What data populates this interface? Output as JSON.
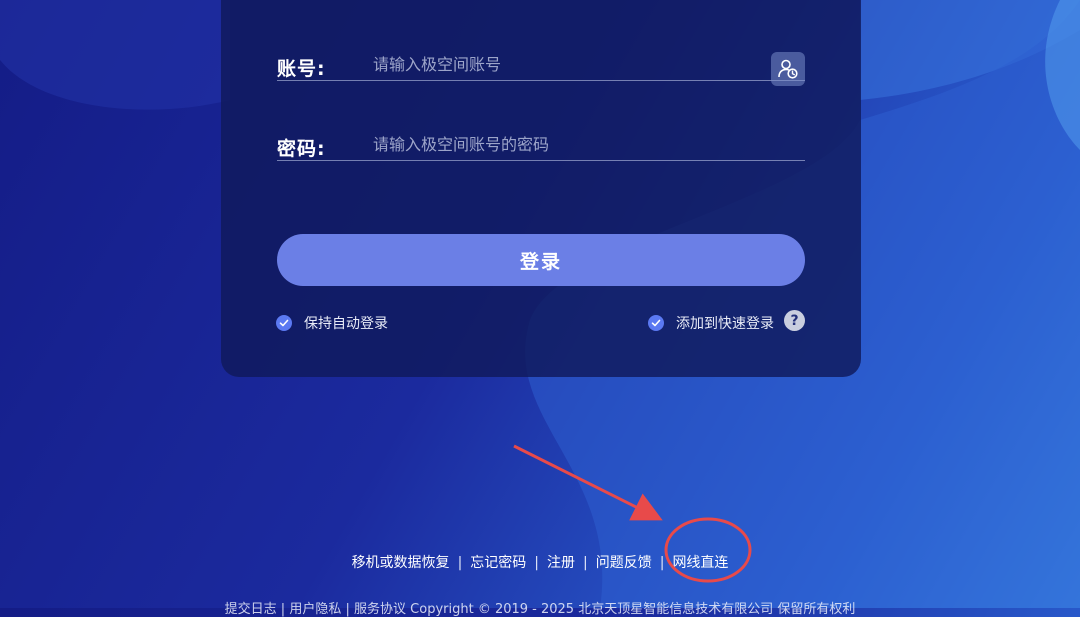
{
  "login": {
    "account_label": "账号:",
    "account_placeholder": "请输入极空间账号",
    "password_label": "密码:",
    "password_placeholder": "请输入极空间账号的密码",
    "submit_label": "登录",
    "auto_login_label": "保持自动登录",
    "auto_login_checked": true,
    "quick_login_label": "添加到快速登录",
    "quick_login_checked": true,
    "help_symbol": "?"
  },
  "links": {
    "items": [
      "移机或数据恢复",
      "忘记密码",
      "注册",
      "问题反馈",
      "网线直连"
    ],
    "separator": "|"
  },
  "footer": {
    "submit_log": "提交日志",
    "privacy": "用户隐私",
    "terms": "服务协议",
    "divider": "|",
    "copyright": "Copyright © 2019 - 2025 北京天顶星智能信息技术有限公司 保留所有权利"
  },
  "icons": {
    "user_history": "user-clock-icon",
    "checkmark": "check-icon",
    "help": "question-icon"
  },
  "colors": {
    "accent": "#6b7fe6",
    "check": "#5b79f2",
    "annotation": "#e84a4a"
  }
}
